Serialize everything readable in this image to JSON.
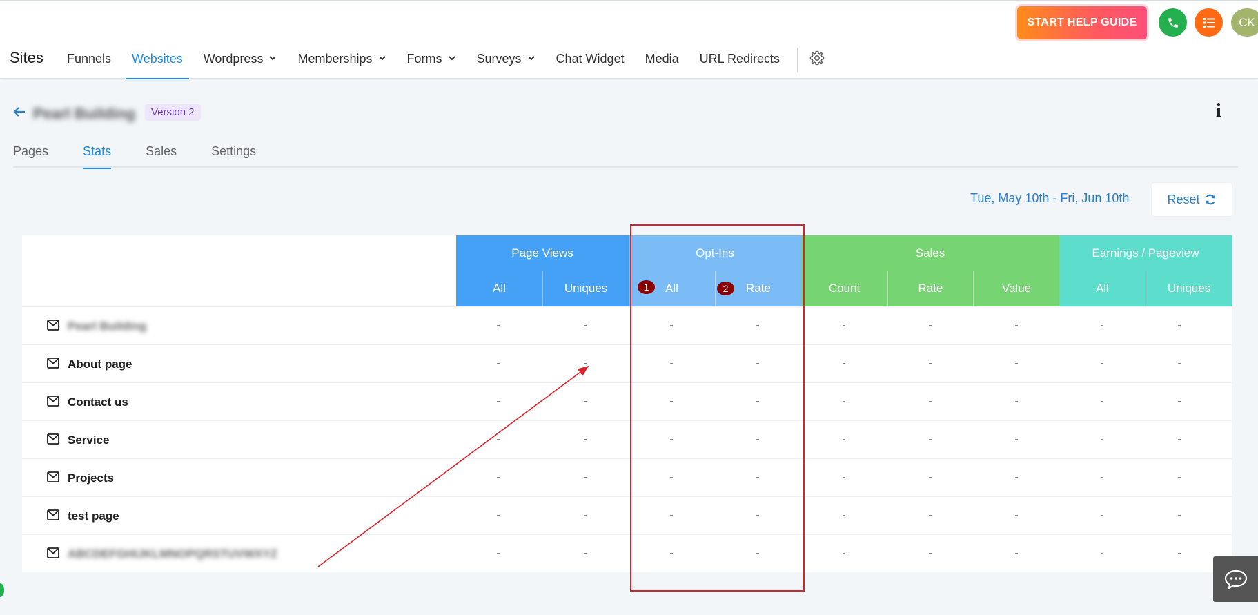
{
  "header": {
    "brand": "Sites",
    "nav": [
      {
        "label": "Funnels",
        "dropdown": false,
        "active": false
      },
      {
        "label": "Websites",
        "dropdown": false,
        "active": true
      },
      {
        "label": "Wordpress",
        "dropdown": true,
        "active": false
      },
      {
        "label": "Memberships",
        "dropdown": true,
        "active": false
      },
      {
        "label": "Forms",
        "dropdown": true,
        "active": false
      },
      {
        "label": "Surveys",
        "dropdown": true,
        "active": false
      },
      {
        "label": "Chat Widget",
        "dropdown": false,
        "active": false
      },
      {
        "label": "Media",
        "dropdown": false,
        "active": false
      },
      {
        "label": "URL Redirects",
        "dropdown": false,
        "active": false
      }
    ],
    "help_button": "START HELP GUIDE",
    "avatar_initials": "CK"
  },
  "site": {
    "name": "Pearl Building",
    "version": "Version 2",
    "info_icon": "i"
  },
  "tabs": [
    {
      "label": "Pages",
      "active": false
    },
    {
      "label": "Stats",
      "active": true
    },
    {
      "label": "Sales",
      "active": false
    },
    {
      "label": "Settings",
      "active": false
    }
  ],
  "date_range": "Tue, May 10th - Fri, Jun 10th",
  "reset_label": "Reset",
  "table": {
    "groups": [
      {
        "label": "Page Views",
        "sub": [
          "All",
          "Uniques"
        ]
      },
      {
        "label": "Opt-Ins",
        "sub": [
          "All",
          "Rate"
        ]
      },
      {
        "label": "Sales",
        "sub": [
          "Count",
          "Rate",
          "Value"
        ]
      },
      {
        "label": "Earnings / Pageview",
        "sub": [
          "All",
          "Uniques"
        ]
      }
    ],
    "badges": [
      "1",
      "2"
    ],
    "empty_value": "-",
    "rows": [
      {
        "label": "Pearl Building",
        "blurred": true
      },
      {
        "label": "About page",
        "blurred": false
      },
      {
        "label": "Contact us",
        "blurred": false
      },
      {
        "label": "Service",
        "blurred": false
      },
      {
        "label": "Projects",
        "blurred": false
      },
      {
        "label": "test page",
        "blurred": false
      },
      {
        "label": "ABCDEFGHIJKLMNOPQRSTUVWXYZ",
        "blurred": true
      }
    ]
  },
  "colors": {
    "accent": "#1f8ce6",
    "page_views": "#44a1f5",
    "opt_ins": "#7bbcf7",
    "sales": "#76d572",
    "earnings": "#5dddcc",
    "annotation": "#d8232a"
  },
  "icons": {
    "back": "arrow-left-icon",
    "settings": "gear-icon",
    "phone": "phone-icon",
    "list": "list-icon",
    "reset": "refresh-icon",
    "row": "mail-icon",
    "chat": "chat-icon"
  }
}
